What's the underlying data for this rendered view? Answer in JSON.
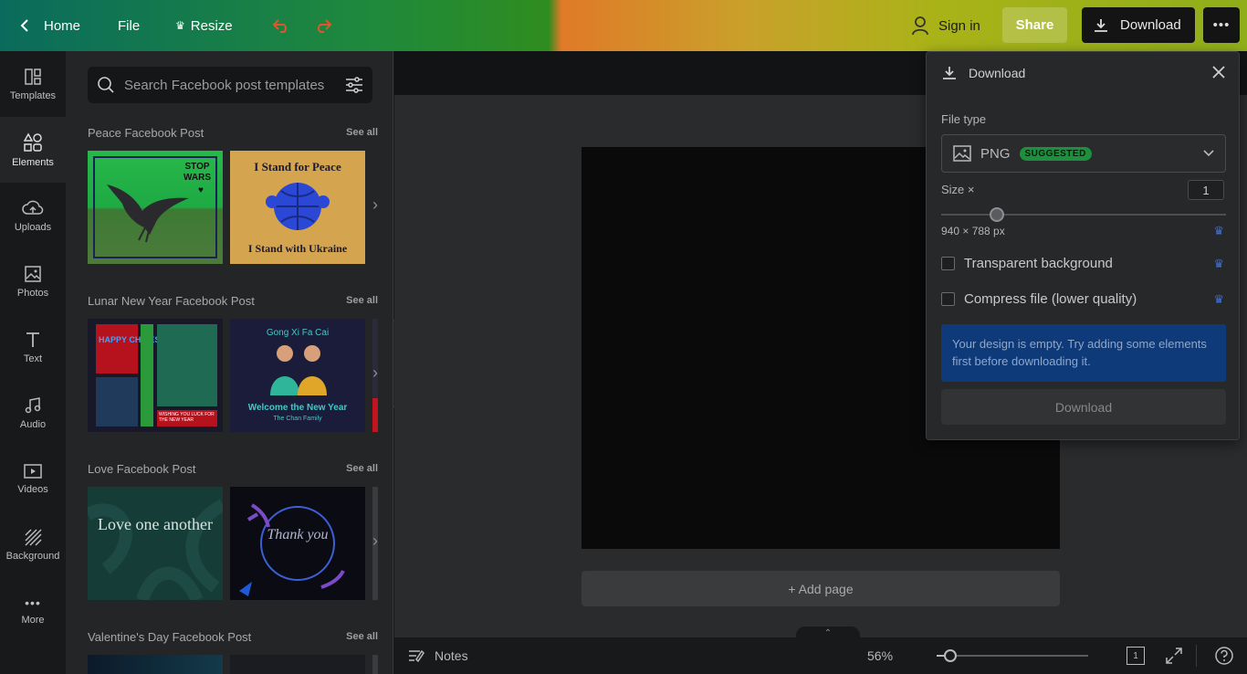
{
  "topbar": {
    "home_label": "Home",
    "file_label": "File",
    "resize_label": "Resize",
    "signin_label": "Sign in",
    "share_label": "Share",
    "download_label": "Download"
  },
  "rail": {
    "items": [
      {
        "label": "Templates"
      },
      {
        "label": "Elements"
      },
      {
        "label": "Uploads"
      },
      {
        "label": "Photos"
      },
      {
        "label": "Text"
      },
      {
        "label": "Audio"
      },
      {
        "label": "Videos"
      },
      {
        "label": "Background"
      },
      {
        "label": "More"
      }
    ]
  },
  "panel": {
    "search_placeholder": "Search Facebook post templates",
    "see_all": "See all",
    "sections": [
      {
        "title": "Peace Facebook Post"
      },
      {
        "title": "Lunar New Year Facebook Post"
      },
      {
        "title": "Love Facebook Post"
      },
      {
        "title": "Valentine's Day Facebook Post"
      }
    ],
    "thumbs": {
      "stop_wars": "STOP WARS",
      "stand_peace": "I Stand for Peace",
      "stand_ukraine": "I Stand with Ukraine",
      "happy_cny": "HAPPY CHINESE NEW YEAR",
      "cny_small": "WISHING YOU LUCK FOR THE NEW YEAR",
      "gong_xi": "Gong Xi Fa Cai",
      "welcome_year": "Welcome the New Year",
      "chan_family": "The Chan Family",
      "love_one": "Love one another",
      "thank_you": "Thank you"
    }
  },
  "canvas": {
    "add_page": "+ Add page",
    "notes_label": "Notes",
    "zoom": "56%",
    "page_number": "1"
  },
  "download_panel": {
    "title": "Download",
    "file_type_label": "File type",
    "file_type_value": "PNG",
    "suggested_badge": "SUGGESTED",
    "size_label": "Size ×",
    "size_value": "1",
    "dimensions": "940 × 788 px",
    "transparent_label": "Transparent background",
    "compress_label": "Compress file (lower quality)",
    "alert_text": "Your design is empty. Try adding some elements first before downloading it.",
    "download_button": "Download"
  }
}
